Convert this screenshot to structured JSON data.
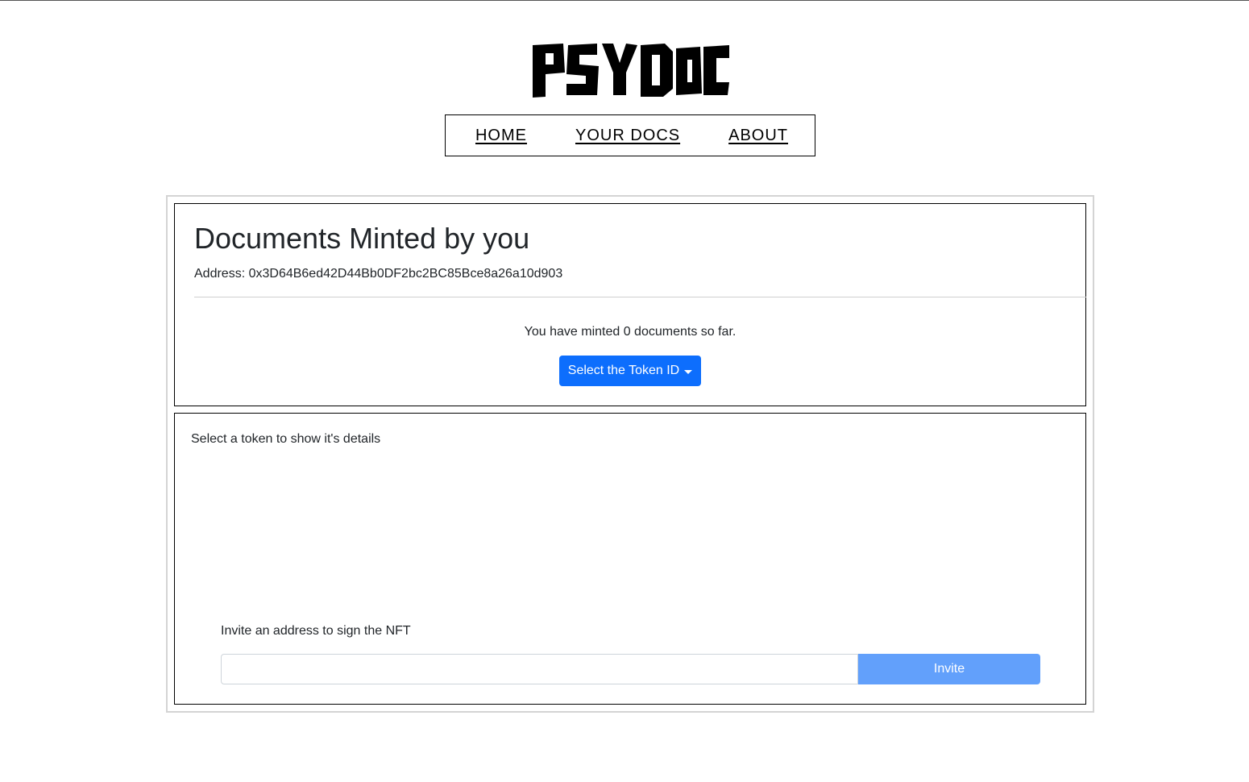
{
  "brand": {
    "logo_text": "PSYDOC"
  },
  "nav": {
    "items": [
      {
        "label": "HOME"
      },
      {
        "label": "YOUR DOCS"
      },
      {
        "label": "ABOUT"
      }
    ]
  },
  "minted_panel": {
    "title": "Documents Minted by you",
    "address": "Address: 0x3D64B6ed42D44Bb0DF2bc2BC85Bce8a26a10d903",
    "minted_text": "You have minted 0 documents so far.",
    "token_button_label": "Select the Token ID"
  },
  "details_panel": {
    "hint": "Select a token to show it's details",
    "invite_label": "Invite an address to sign the NFT",
    "invite_input_value": "",
    "invite_button_label": "Invite"
  },
  "colors": {
    "primary": "#0d6efd",
    "primary_disabled": "#62a0fb"
  }
}
